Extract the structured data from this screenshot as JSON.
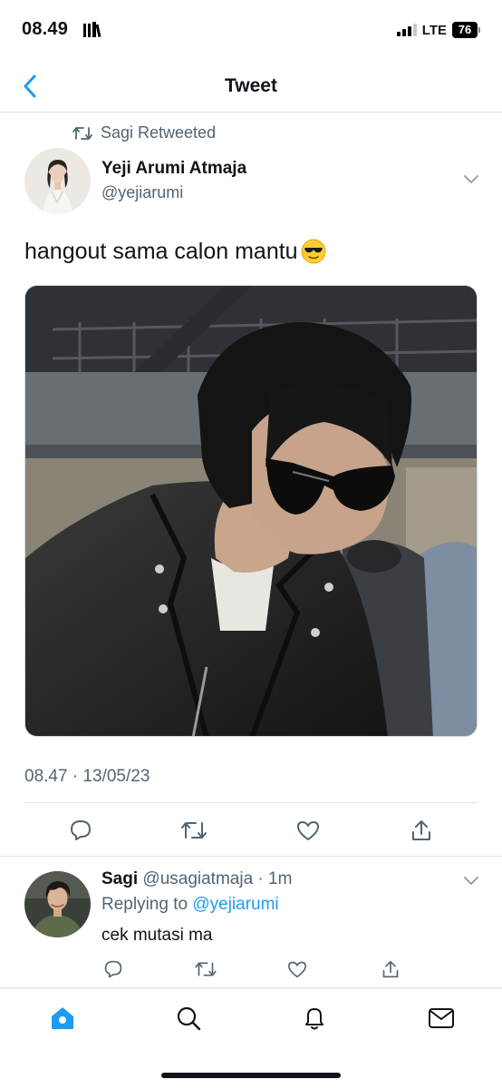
{
  "status_bar": {
    "time": "08.49",
    "network": "LTE",
    "battery": "76"
  },
  "header": {
    "title": "Tweet",
    "accent_color": "#1d9bf0"
  },
  "tweet": {
    "retweeted_by": "Sagi Retweeted",
    "author_name": "Yeji Arumi Atmaja",
    "author_handle": "@yejiarumi",
    "text": "hangout sama calon mantu",
    "emoji": "smiling-face-with-sunglasses",
    "timestamp": "08.47 · 13/05/23",
    "actions": [
      "reply-icon",
      "retweet-icon",
      "like-icon",
      "share-icon"
    ]
  },
  "reply": {
    "author_name": "Sagi",
    "meta": "@usagiatmaja · 1m",
    "replying_prefix": "Replying to",
    "replying_to": "@yejiarumi",
    "text": "cek mutasi ma"
  },
  "tab_bar": {
    "items": [
      "home-icon",
      "search-icon",
      "notifications-icon",
      "messages-icon"
    ],
    "active": "home-icon"
  }
}
